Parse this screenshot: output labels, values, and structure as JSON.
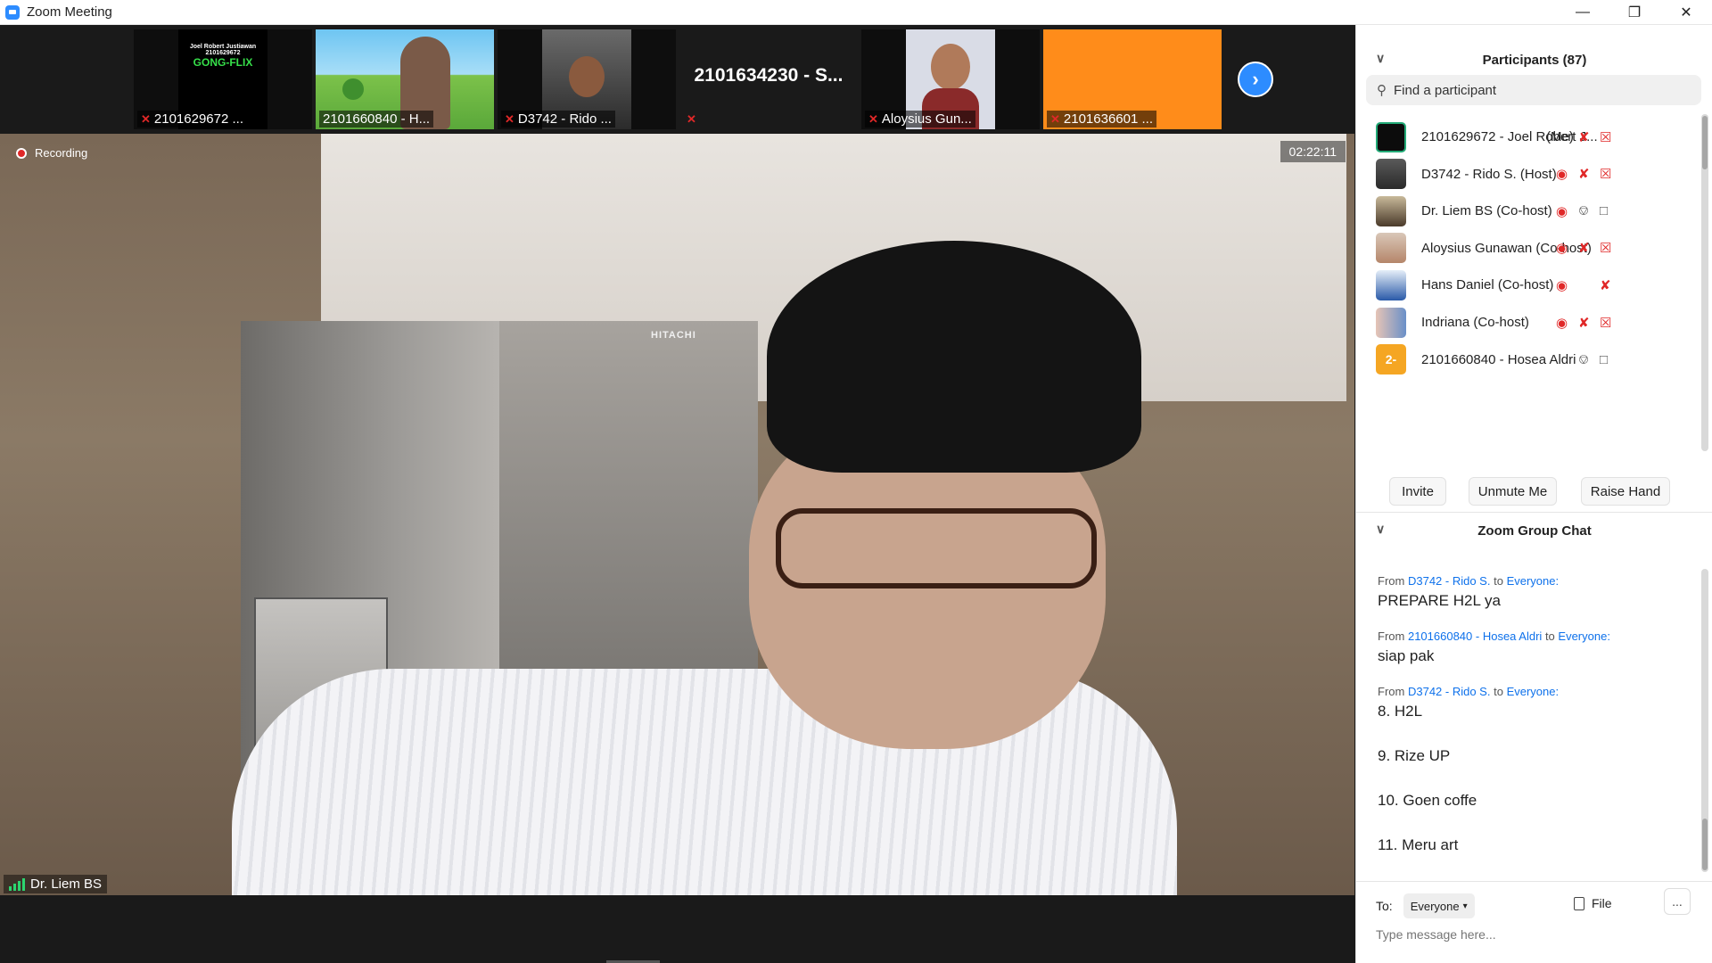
{
  "window": {
    "title": "Zoom Meeting"
  },
  "thumbnails": [
    {
      "label": "2101629672 ...",
      "muted": true,
      "tile": "poster",
      "poster_lines": [
        "Joel Robert Justiawan",
        "2101629672",
        "GONG-FLIX"
      ]
    },
    {
      "label": "2101660840 - H...",
      "muted": false,
      "tile": "scenery"
    },
    {
      "label": "D3742 - Rido ...",
      "muted": true,
      "tile": "photo"
    },
    {
      "label": "",
      "muted": true,
      "tile": "name",
      "name": "2101634230 - S..."
    },
    {
      "label": "Aloysius Gun...",
      "muted": true,
      "tile": "photo"
    },
    {
      "label": "2101636601 ...",
      "muted": true,
      "tile": "color",
      "color": "#ff8c1a"
    }
  ],
  "main_video": {
    "recording_label": "Recording",
    "timer": "02:22:11",
    "speaker": "Dr. Liem BS",
    "fridge_brand": "HITACHI"
  },
  "participants": {
    "header": "Participants (87)",
    "search_placeholder": "Find a participant",
    "list": [
      {
        "name": "2101629672 - Joel Robert J...",
        "suffix": "(Me)",
        "avatar": "dark",
        "rec": false,
        "mic": "off",
        "video": "off"
      },
      {
        "name": "D3742 - Rido S. (Host)",
        "suffix": "",
        "avatar": "photo",
        "rec": true,
        "mic": "off",
        "video": "off"
      },
      {
        "name": "Dr. Liem BS (Co-host)",
        "suffix": "",
        "avatar": "photo",
        "rec": true,
        "mic": "on",
        "video": "on"
      },
      {
        "name": "Aloysius Gunawan (Co-host)",
        "suffix": "",
        "avatar": "photo",
        "rec": true,
        "mic": "off",
        "video": "off"
      },
      {
        "name": "Hans Daniel (Co-host)",
        "suffix": "",
        "avatar": "photo",
        "rec": true,
        "mic": "off",
        "video": "none"
      },
      {
        "name": "Indriana (Co-host)",
        "suffix": "",
        "avatar": "photo",
        "rec": true,
        "mic": "off",
        "video": "off"
      },
      {
        "name": "2101660840 - Hosea Aldri",
        "suffix": "",
        "avatar": "initials",
        "initials": "2-",
        "rec": false,
        "mic": "on",
        "video": "on"
      }
    ],
    "buttons": {
      "invite": "Invite",
      "unmute": "Unmute Me",
      "raise_hand": "Raise Hand"
    }
  },
  "chat": {
    "header": "Zoom Group Chat",
    "from_word": "From",
    "to_word": "to",
    "messages": [
      {
        "sender": "D3742 - Rido S.",
        "recipient": "Everyone:",
        "lines": [
          "PREPARE H2L ya"
        ]
      },
      {
        "sender": "2101660840 - Hosea Aldri",
        "recipient": "Everyone:",
        "lines": [
          "siap pak"
        ]
      },
      {
        "sender": "D3742 - Rido S.",
        "recipient": "Everyone:",
        "lines": [
          "8. H2L",
          "9. Rize UP",
          "10. Goen coffe",
          "11. Meru art"
        ]
      }
    ],
    "compose": {
      "to_label": "To:",
      "recipient": "Everyone",
      "file_label": "File",
      "more_label": "...",
      "placeholder": "Type message here..."
    }
  },
  "colors": {
    "accent": "#2d8cff",
    "link": "#0e71eb",
    "muted_red": "#e02828",
    "avatar_orange": "#f5a623"
  }
}
